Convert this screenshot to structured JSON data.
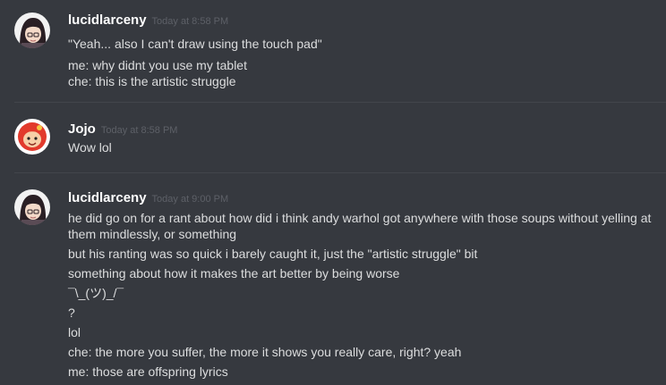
{
  "messages": [
    {
      "username": "lucidlarceny",
      "timestamp": "Today at 8:58 PM",
      "avatar_icon": "dark-haired-girl-avatar",
      "lines": [
        "\"Yeah... also I can't draw using the touch pad\"",
        "me: why didnt you use my tablet\nche: this is the artistic struggle"
      ]
    },
    {
      "username": "Jojo",
      "timestamp": "Today at 8:58 PM",
      "avatar_icon": "red-haired-avatar",
      "lines": [
        "Wow lol"
      ]
    },
    {
      "username": "lucidlarceny",
      "timestamp": "Today at 9:00 PM",
      "avatar_icon": "dark-haired-girl-avatar",
      "lines": [
        "he did go on for a rant about how did i think andy warhol got anywhere with those soups without yelling at them mindlessly, or something",
        "but his ranting was so quick i barely caught it, just the \"artistic struggle\" bit",
        "something about how it makes the art better by being worse",
        "¯\\_(ツ)_/¯",
        "?",
        "lol",
        "che: the more you suffer, the more it shows you really care, right? yeah",
        "me: those are offspring lyrics"
      ]
    }
  ],
  "colors": {
    "background": "#36393f",
    "username": "#ffffff",
    "timestamp": "#5d6067",
    "text": "#dcddde",
    "divider": "#42454b"
  }
}
